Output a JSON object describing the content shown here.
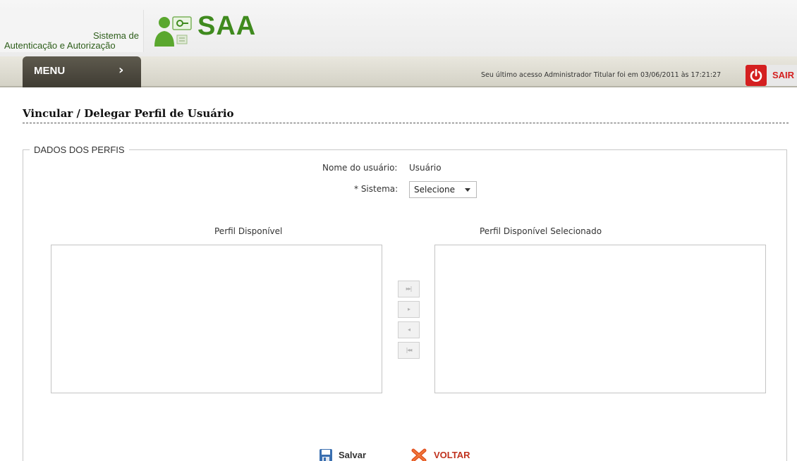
{
  "header": {
    "system_line1": "Sistema de",
    "system_line2": "Autenticação e Autorização",
    "logo_text": "SAA",
    "logo_icon": "user-key-icon"
  },
  "menubar": {
    "menu_label": "MENU",
    "menu_arrow": "›",
    "last_access": "Seu último acesso Administrador Titular foi em 03/06/2011 às 17:21:27",
    "logout_label": "SAIR",
    "logout_icon": "power-icon"
  },
  "page": {
    "title": "Vincular / Delegar Perfil de Usuário"
  },
  "form": {
    "legend": "DADOS DOS PERFIS",
    "user_name_label": "Nome do usuário:",
    "user_name_value": "Usuário",
    "system_label": "* Sistema:",
    "system_selected": "Selecione",
    "available_header": "Perfil Disponível",
    "selected_header": "Perfil Disponível Selecionado",
    "available_items": [],
    "selected_items": [],
    "move_buttons": [
      {
        "name": "move-all-right",
        "glyph": "▸▸|"
      },
      {
        "name": "move-right",
        "glyph": "▸"
      },
      {
        "name": "move-left",
        "glyph": "◂"
      },
      {
        "name": "move-all-left",
        "glyph": "|◂◂"
      }
    ]
  },
  "actions": {
    "save_label": "Salvar",
    "save_icon": "floppy-disk-icon",
    "back_label": "VOLTAR",
    "back_icon": "x-cross-icon"
  },
  "colors": {
    "brand_green": "#3f8a1e",
    "menu_dark": "#4a473d",
    "logout_red": "#d42020",
    "back_red": "#c0321e"
  }
}
